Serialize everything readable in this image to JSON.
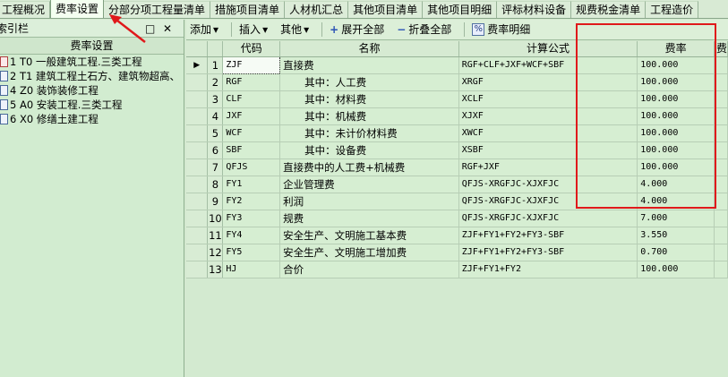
{
  "tabs": [
    {
      "label": "工程概况",
      "active": false
    },
    {
      "label": "费率设置",
      "active": true
    },
    {
      "label": "分部分项工程量清单",
      "active": false
    },
    {
      "label": "措施项目清单",
      "active": false
    },
    {
      "label": "人材机汇总",
      "active": false
    },
    {
      "label": "其他项目清单",
      "active": false
    },
    {
      "label": "其他项目明细",
      "active": false
    },
    {
      "label": "评标材料设备",
      "active": false
    },
    {
      "label": "规费税金清单",
      "active": false
    },
    {
      "label": "工程造价",
      "active": false
    }
  ],
  "left_panel": {
    "title": "索引栏",
    "pin_glyph": "□",
    "close_glyph": "✕",
    "subtitle": "费率设置",
    "items": [
      "1 T0 一般建筑工程.三类工程",
      "2 T1 建筑工程土石方、建筑物超高、",
      "4 Z0 装饰装修工程",
      "5 A0 安装工程.三类工程",
      "6 X0 修缮土建工程"
    ]
  },
  "toolbar": {
    "add": "添加",
    "insert": "插入",
    "other": "其他",
    "expand_all": "展开全部",
    "collapse_all": "折叠全部",
    "rate_detail": "费率明细",
    "dropdown_glyph": "▾",
    "plus_glyph": "+",
    "minus_glyph": "−",
    "pct_glyph": "%"
  },
  "grid": {
    "headers": {
      "code": "代码",
      "name": "名称",
      "formula": "计算公式",
      "rate": "费率",
      "extra": "费"
    },
    "current_marker": "▶",
    "rows": [
      {
        "no": "1",
        "code": "ZJF",
        "name": "直接费",
        "formula": "RGF+CLF+JXF+WCF+SBF",
        "rate": "100.000",
        "indent": false
      },
      {
        "no": "2",
        "code": "RGF",
        "name": "其中：人工费",
        "formula": "XRGF",
        "rate": "100.000",
        "indent": true
      },
      {
        "no": "3",
        "code": "CLF",
        "name": "其中：材料费",
        "formula": "XCLF",
        "rate": "100.000",
        "indent": true
      },
      {
        "no": "4",
        "code": "JXF",
        "name": "其中：机械费",
        "formula": "XJXF",
        "rate": "100.000",
        "indent": true
      },
      {
        "no": "5",
        "code": "WCF",
        "name": "其中：未计价材料费",
        "formula": "XWCF",
        "rate": "100.000",
        "indent": true
      },
      {
        "no": "6",
        "code": "SBF",
        "name": "其中：设备费",
        "formula": "XSBF",
        "rate": "100.000",
        "indent": true
      },
      {
        "no": "7",
        "code": "QFJS",
        "name": "直接费中的人工费+机械费",
        "formula": "RGF+JXF",
        "rate": "100.000",
        "indent": false
      },
      {
        "no": "8",
        "code": "FY1",
        "name": "企业管理费",
        "formula": "QFJS-XRGFJC-XJXFJC",
        "rate": "4.000",
        "indent": false
      },
      {
        "no": "9",
        "code": "FY2",
        "name": "利润",
        "formula": "QFJS-XRGFJC-XJXFJC",
        "rate": "4.000",
        "indent": false
      },
      {
        "no": "10",
        "code": "FY3",
        "name": "规费",
        "formula": "QFJS-XRGFJC-XJXFJC",
        "rate": "7.000",
        "indent": false
      },
      {
        "no": "11",
        "code": "FY4",
        "name": "安全生产、文明施工基本费",
        "formula": "ZJF+FY1+FY2+FY3-SBF",
        "rate": "3.550",
        "indent": false
      },
      {
        "no": "12",
        "code": "FY5",
        "name": "安全生产、文明施工增加费",
        "formula": "ZJF+FY1+FY2+FY3-SBF",
        "rate": "0.700",
        "indent": false
      },
      {
        "no": "13",
        "code": "HJ",
        "name": "合价",
        "formula": "ZJF+FY1+FY2",
        "rate": "100.000",
        "indent": false
      }
    ]
  },
  "colors": {
    "annotation_red": "#e0191b",
    "background_green": "#d3ead0"
  }
}
